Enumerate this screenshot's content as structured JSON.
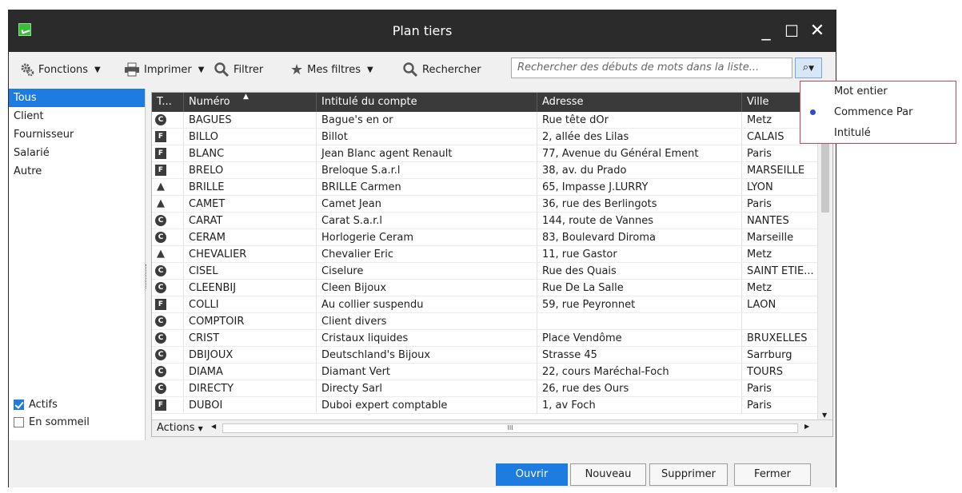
{
  "window": {
    "title": "Plan tiers",
    "minimize": "_",
    "maximize": "☐",
    "close": "✕"
  },
  "toolbar": {
    "fonctions": "Fonctions",
    "imprimer": "Imprimer",
    "filtrer": "Filtrer",
    "mes_filtres": "Mes filtres",
    "rechercher": "Rechercher",
    "search_placeholder": "Rechercher des débuts de mots dans la liste..."
  },
  "sidebar": {
    "items": [
      "Tous",
      "Client",
      "Fournisseur",
      "Salarié",
      "Autre"
    ],
    "selected": "Tous",
    "checks": [
      {
        "label": "Actifs",
        "checked": true
      },
      {
        "label": "En sommeil",
        "checked": false
      }
    ]
  },
  "table": {
    "columns": [
      "T...",
      "Numéro",
      "Intitulé du compte",
      "Adresse",
      "Ville"
    ],
    "rows": [
      {
        "type": "C",
        "numero": "BAGUES",
        "intitule": "Bague's en or",
        "adresse": "Rue tête dOr",
        "ville": "Metz"
      },
      {
        "type": "F",
        "numero": "BILLO",
        "intitule": "Billot",
        "adresse": "2, allée des Lilas",
        "ville": "CALAIS"
      },
      {
        "type": "F",
        "numero": "BLANC",
        "intitule": "Jean Blanc agent Renault",
        "adresse": "77, Avenue du Général Ement",
        "ville": "Paris"
      },
      {
        "type": "F",
        "numero": "BRELO",
        "intitule": "Breloque S.a.r.l",
        "adresse": "38, av. du Prado",
        "ville": "MARSEILLE"
      },
      {
        "type": "S",
        "numero": "BRILLE",
        "intitule": "BRILLE Carmen",
        "adresse": "65, Impasse J.LURRY",
        "ville": "LYON"
      },
      {
        "type": "S",
        "numero": "CAMET",
        "intitule": "Camet Jean",
        "adresse": "36, rue des Berlingots",
        "ville": "Paris"
      },
      {
        "type": "C",
        "numero": "CARAT",
        "intitule": "Carat S.a.r.l",
        "adresse": "144, route de Vannes",
        "ville": "NANTES"
      },
      {
        "type": "C",
        "numero": "CERAM",
        "intitule": "Horlogerie Ceram",
        "adresse": "83, Boulevard Diroma",
        "ville": "Marseille"
      },
      {
        "type": "S",
        "numero": "CHEVALIER",
        "intitule": "Chevalier Eric",
        "adresse": "11, rue Gastor",
        "ville": "Metz"
      },
      {
        "type": "C",
        "numero": "CISEL",
        "intitule": "Ciselure",
        "adresse": "Rue des Quais",
        "ville": "SAINT ETIE..."
      },
      {
        "type": "C",
        "numero": "CLEENBIJ",
        "intitule": "Cleen Bijoux",
        "adresse": "Rue De La Salle",
        "ville": "Metz"
      },
      {
        "type": "F",
        "numero": "COLLI",
        "intitule": "Au collier suspendu",
        "adresse": "59, rue Peyronnet",
        "ville": "LAON"
      },
      {
        "type": "C",
        "numero": "COMPTOIR",
        "intitule": "Client divers",
        "adresse": "",
        "ville": ""
      },
      {
        "type": "C",
        "numero": "CRIST",
        "intitule": "Cristaux liquides",
        "adresse": "Place Vendôme",
        "ville": "BRUXELLES"
      },
      {
        "type": "C",
        "numero": "DBIJOUX",
        "intitule": "Deutschland's Bijoux",
        "adresse": "Strasse 45",
        "ville": "Sarrburg"
      },
      {
        "type": "C",
        "numero": "DIAMA",
        "intitule": "Diamant Vert",
        "adresse": "22, cours Maréchal-Foch",
        "ville": "TOURS"
      },
      {
        "type": "C",
        "numero": "DIRECTY",
        "intitule": "Directy Sarl",
        "adresse": "26, rue des Ours",
        "ville": "Paris"
      },
      {
        "type": "F",
        "numero": "DUBOI",
        "intitule": "Duboi expert comptable",
        "adresse": "1, av Foch",
        "ville": "Paris"
      }
    ],
    "actions_label": "Actions",
    "hscroll_mark": "III"
  },
  "buttons": {
    "ouvrir": "Ouvrir",
    "nouveau": "Nouveau",
    "supprimer": "Supprimer",
    "fermer": "Fermer"
  },
  "search_menu": {
    "items": [
      "Mot entier",
      "Commence Par",
      "Intitulé"
    ],
    "selected": "Commence Par"
  },
  "colors": {
    "accent": "#1e7ce0",
    "titlebar": "#2b2b2b",
    "header": "#3a3a3a",
    "menu_border": "#d04050"
  }
}
